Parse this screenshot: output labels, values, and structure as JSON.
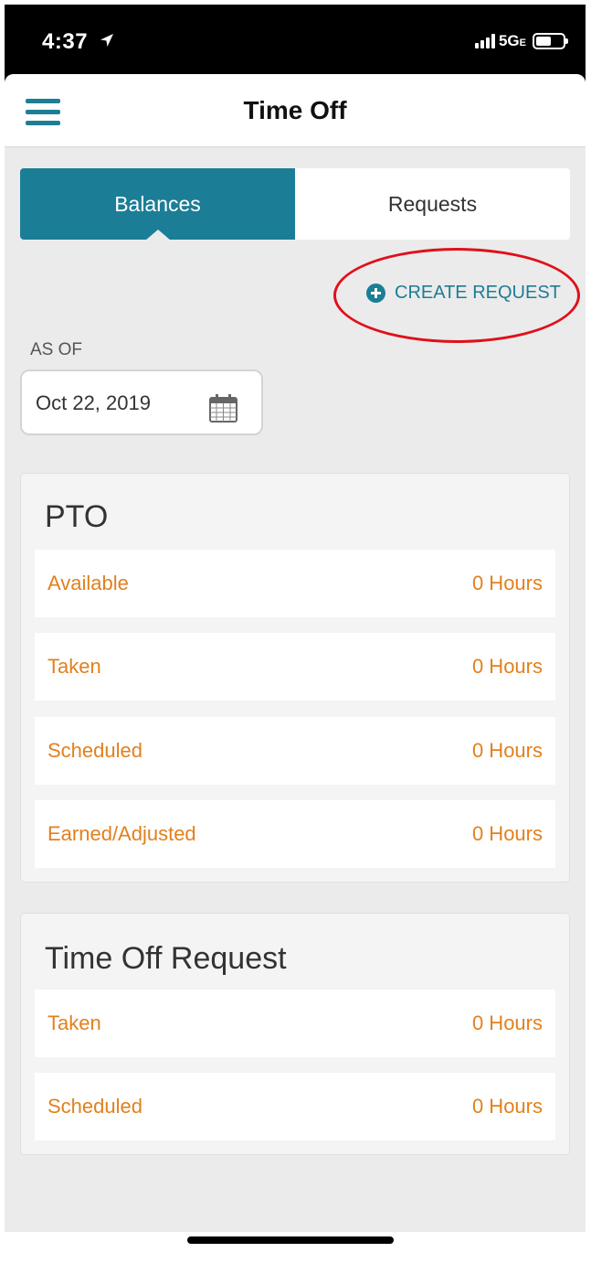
{
  "status_bar": {
    "time": "4:37",
    "network": "5G",
    "network_suffix": "E"
  },
  "nav": {
    "title": "Time Off"
  },
  "tabs": [
    {
      "label": "Balances",
      "active": true
    },
    {
      "label": "Requests",
      "active": false
    }
  ],
  "create_request": {
    "label": "CREATE REQUEST"
  },
  "as_of": {
    "label": "AS OF",
    "date": "Oct 22, 2019"
  },
  "cards": [
    {
      "title": "PTO",
      "rows": [
        {
          "label": "Available",
          "value": "0 Hours"
        },
        {
          "label": "Taken",
          "value": "0 Hours"
        },
        {
          "label": "Scheduled",
          "value": "0 Hours"
        },
        {
          "label": "Earned/Adjusted",
          "value": "0 Hours"
        }
      ]
    },
    {
      "title": "Time Off Request",
      "rows": [
        {
          "label": "Taken",
          "value": "0 Hours"
        },
        {
          "label": "Scheduled",
          "value": "0 Hours"
        }
      ]
    }
  ],
  "colors": {
    "accent": "#1c7d96",
    "row_text": "#e2801d",
    "annotation": "#e0101a",
    "background": "#ebebeb"
  }
}
